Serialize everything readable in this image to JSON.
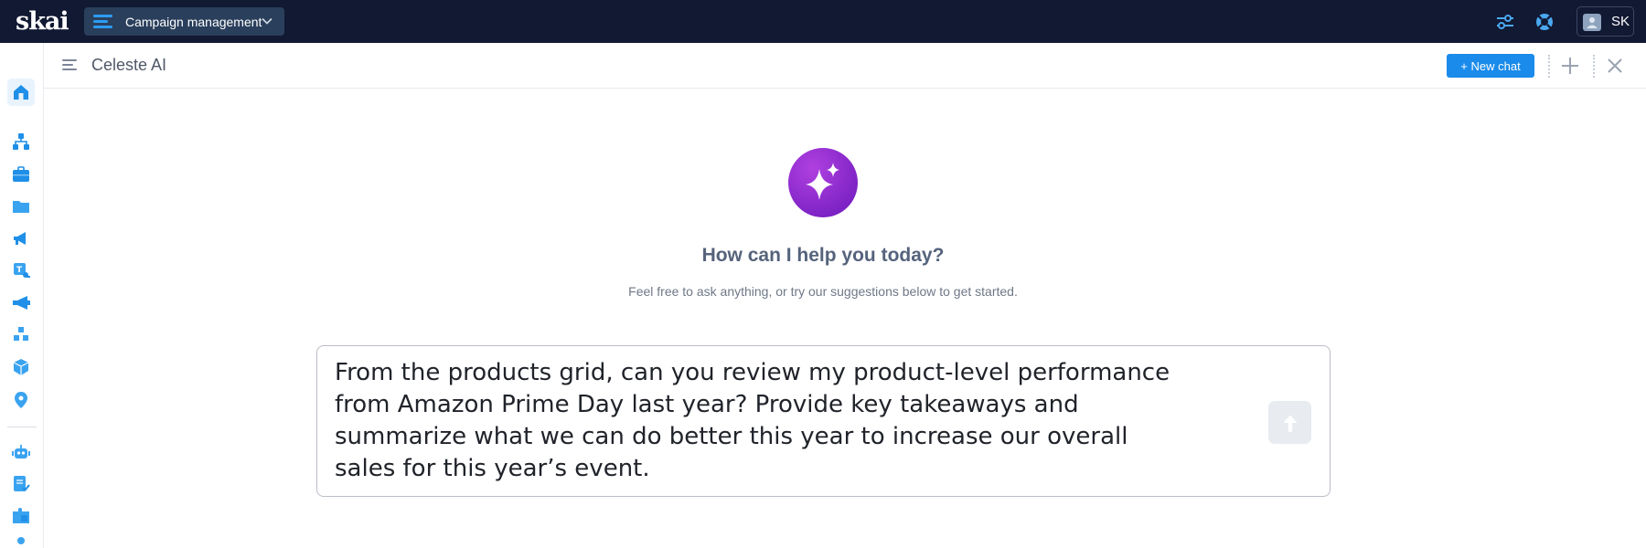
{
  "topbar": {
    "logo": "skai",
    "product_switcher": {
      "label": "Campaign management",
      "icon": "hamburger-lines-icon"
    },
    "icons": [
      "sliders-icon",
      "lifebuoy-icon"
    ],
    "user": {
      "initials": "SK"
    }
  },
  "leftnav": {
    "items": [
      {
        "name": "home-icon",
        "active": true
      },
      {
        "name": "hierarchy-icon"
      },
      {
        "name": "briefcase-icon"
      },
      {
        "name": "folder-icon"
      },
      {
        "name": "megaphone-icon"
      },
      {
        "name": "tag-key-icon"
      },
      {
        "name": "bullhorn-icon"
      },
      {
        "name": "cubes-icon"
      },
      {
        "name": "cube-icon"
      },
      {
        "name": "location-pin-icon"
      },
      {
        "name": "robot-icon"
      },
      {
        "name": "clipboard-check-icon"
      },
      {
        "name": "puzzle-icon"
      },
      {
        "name": "person-icon"
      }
    ]
  },
  "header": {
    "title": "Celeste AI",
    "new_chat_label": "+ New chat"
  },
  "main": {
    "headline": "How can I help you today?",
    "subline": "Feel free to ask anything, or try our suggestions below to get started.",
    "prompt": "From the products grid, can you review my product-level performance\nfrom Amazon Prime Day last year? Provide key takeaways and\nsummarize what we can do better this year to increase our overall\nsales for this year’s event."
  },
  "colors": {
    "topbar_bg": "#121933",
    "accent": "#1a8bea",
    "ai_purple": "#8a2bd0"
  }
}
